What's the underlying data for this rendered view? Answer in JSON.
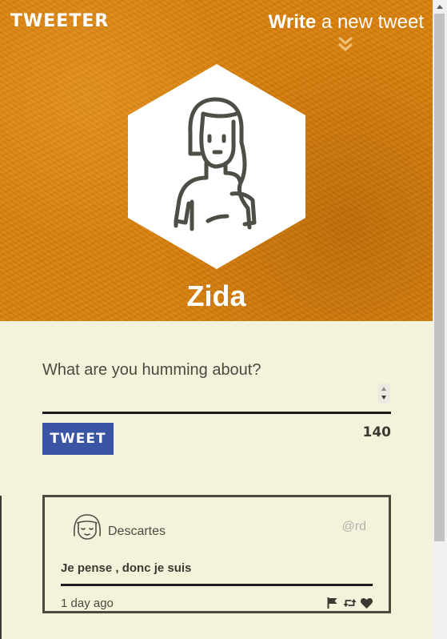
{
  "header": {
    "brand": "TWEETER",
    "write_bold": "Write",
    "write_rest": "a new tweet",
    "chevron_icon": "double-chevron-down-icon"
  },
  "profile": {
    "avatar_icon": "girl-avatar-icon",
    "name": "Zida"
  },
  "composer": {
    "placeholder": "What are you humming about?",
    "value": "",
    "button_label": "TWEET",
    "char_count": "140"
  },
  "feed": {
    "tweets": [
      {
        "avatar_icon": "girl-avatar-icon",
        "user": "Descartes",
        "handle": "@rd",
        "text": "Je pense , donc je suis",
        "time": "1 day ago",
        "actions": [
          "flag-icon",
          "retweet-icon",
          "heart-icon"
        ]
      }
    ]
  },
  "colors": {
    "hero": "#d9800b",
    "panel": "#f3f3dc",
    "button": "#3a55a3",
    "dark": "#3b3a32"
  }
}
